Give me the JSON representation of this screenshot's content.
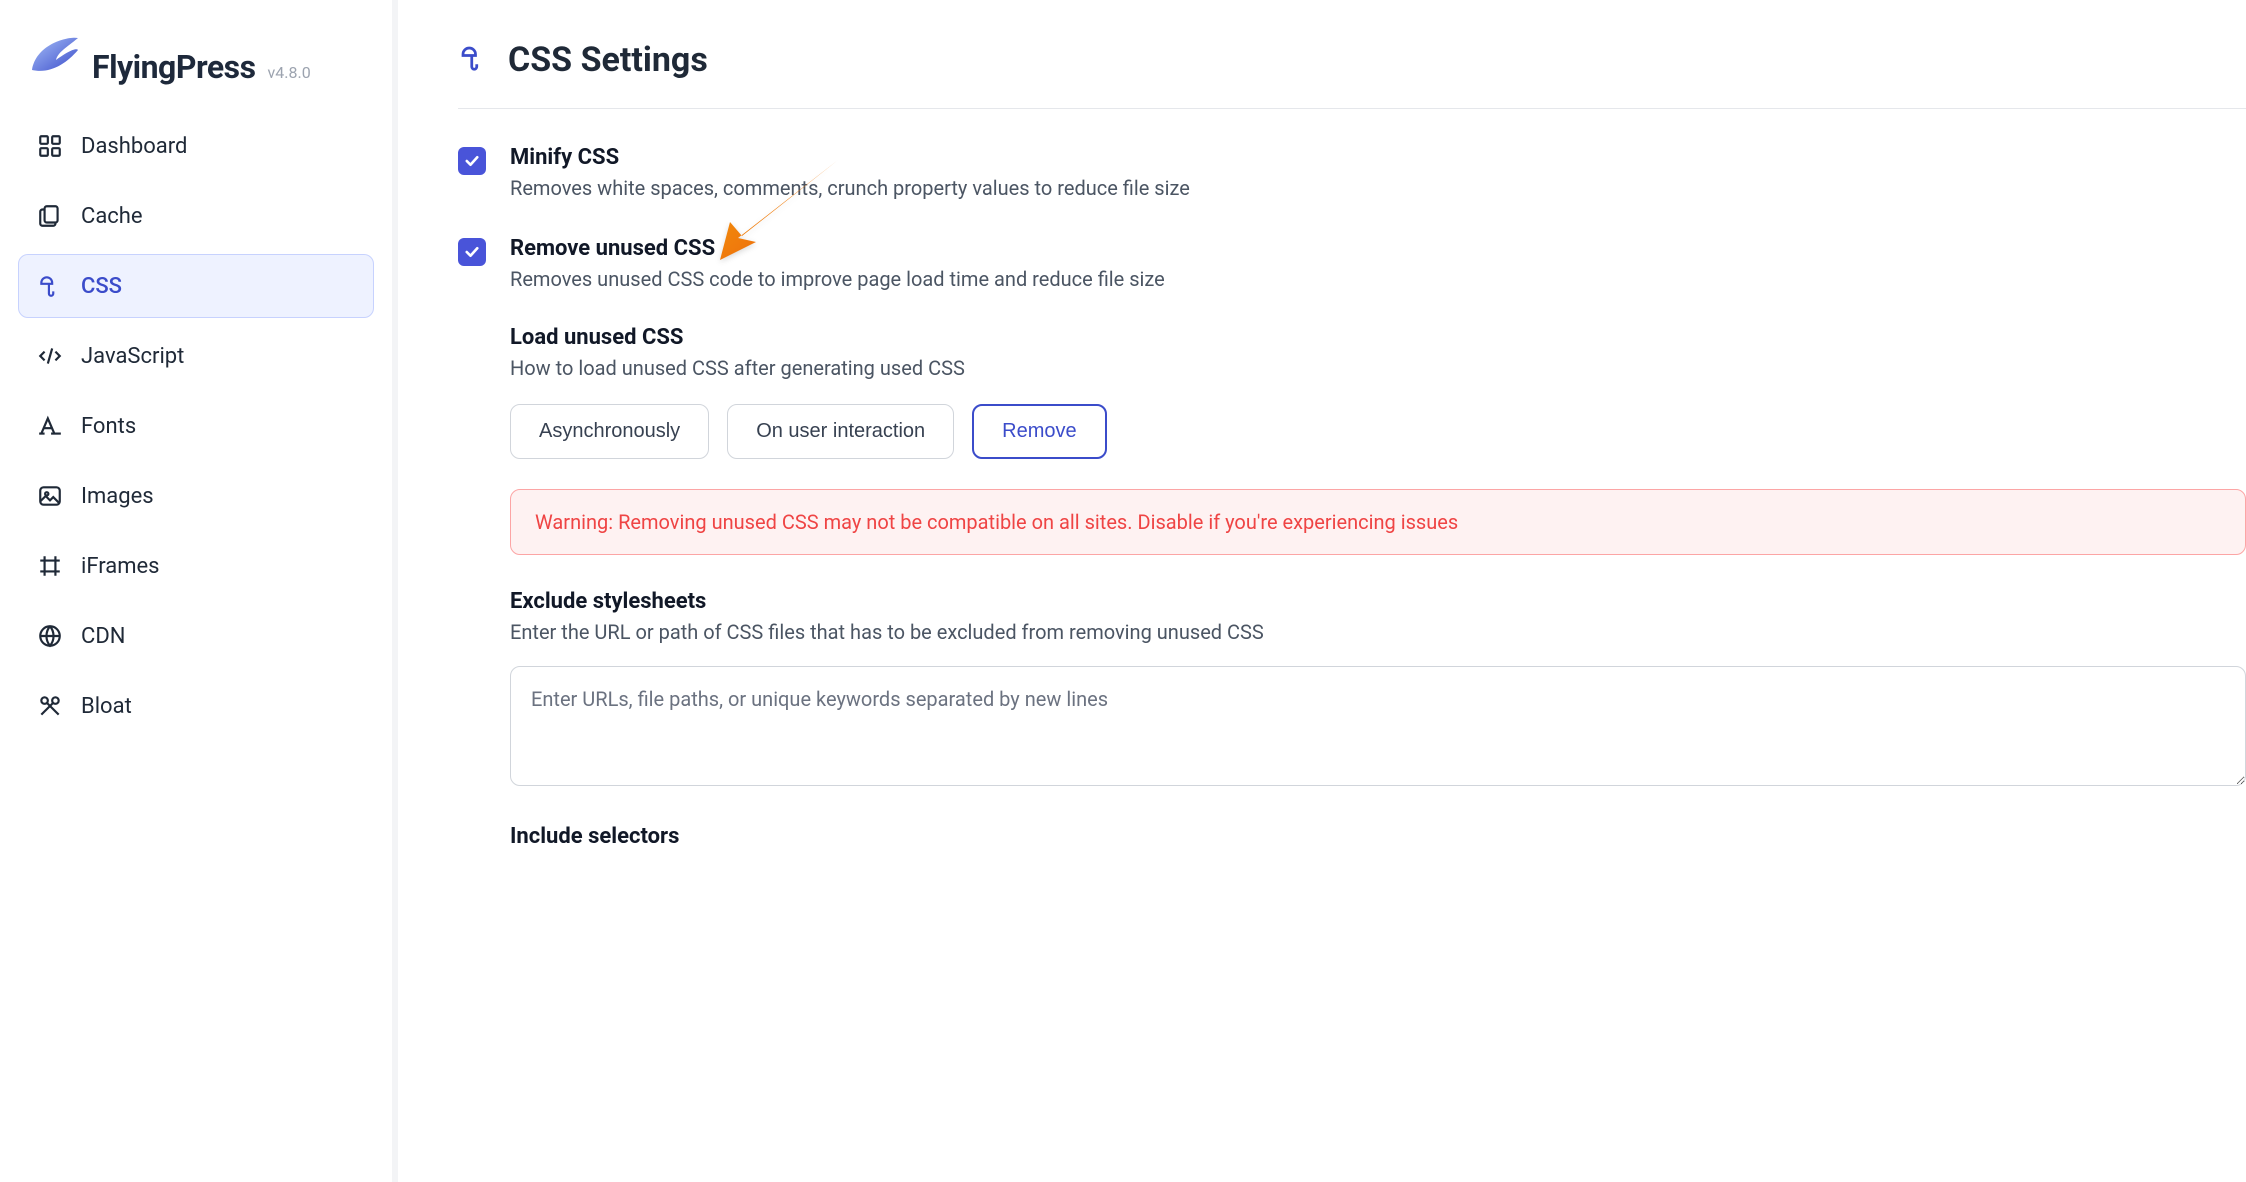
{
  "brand": {
    "name": "FlyingPress",
    "version": "v4.8.0"
  },
  "sidebar": {
    "items": [
      {
        "label": "Dashboard"
      },
      {
        "label": "Cache"
      },
      {
        "label": "CSS"
      },
      {
        "label": "JavaScript"
      },
      {
        "label": "Fonts"
      },
      {
        "label": "Images"
      },
      {
        "label": "iFrames"
      },
      {
        "label": "CDN"
      },
      {
        "label": "Bloat"
      }
    ]
  },
  "page": {
    "title": "CSS Settings"
  },
  "settings": {
    "minify": {
      "title": "Minify CSS",
      "desc": "Removes white spaces, comments, crunch property values to reduce file size"
    },
    "remove_unused": {
      "title": "Remove unused CSS",
      "desc": "Removes unused CSS code to improve page load time and reduce file size"
    },
    "load_unused": {
      "title": "Load unused CSS",
      "desc": "How to load unused CSS after generating used CSS",
      "options": {
        "async": "Asynchronously",
        "interaction": "On user interaction",
        "remove": "Remove"
      }
    },
    "warning": "Warning: Removing unused CSS may not be compatible on all sites. Disable if you're experiencing issues",
    "exclude": {
      "title": "Exclude stylesheets",
      "desc": "Enter the URL or path of CSS files that has to be excluded from removing unused CSS",
      "placeholder": "Enter URLs, file paths, or unique keywords separated by new lines"
    },
    "include": {
      "title": "Include selectors"
    }
  }
}
